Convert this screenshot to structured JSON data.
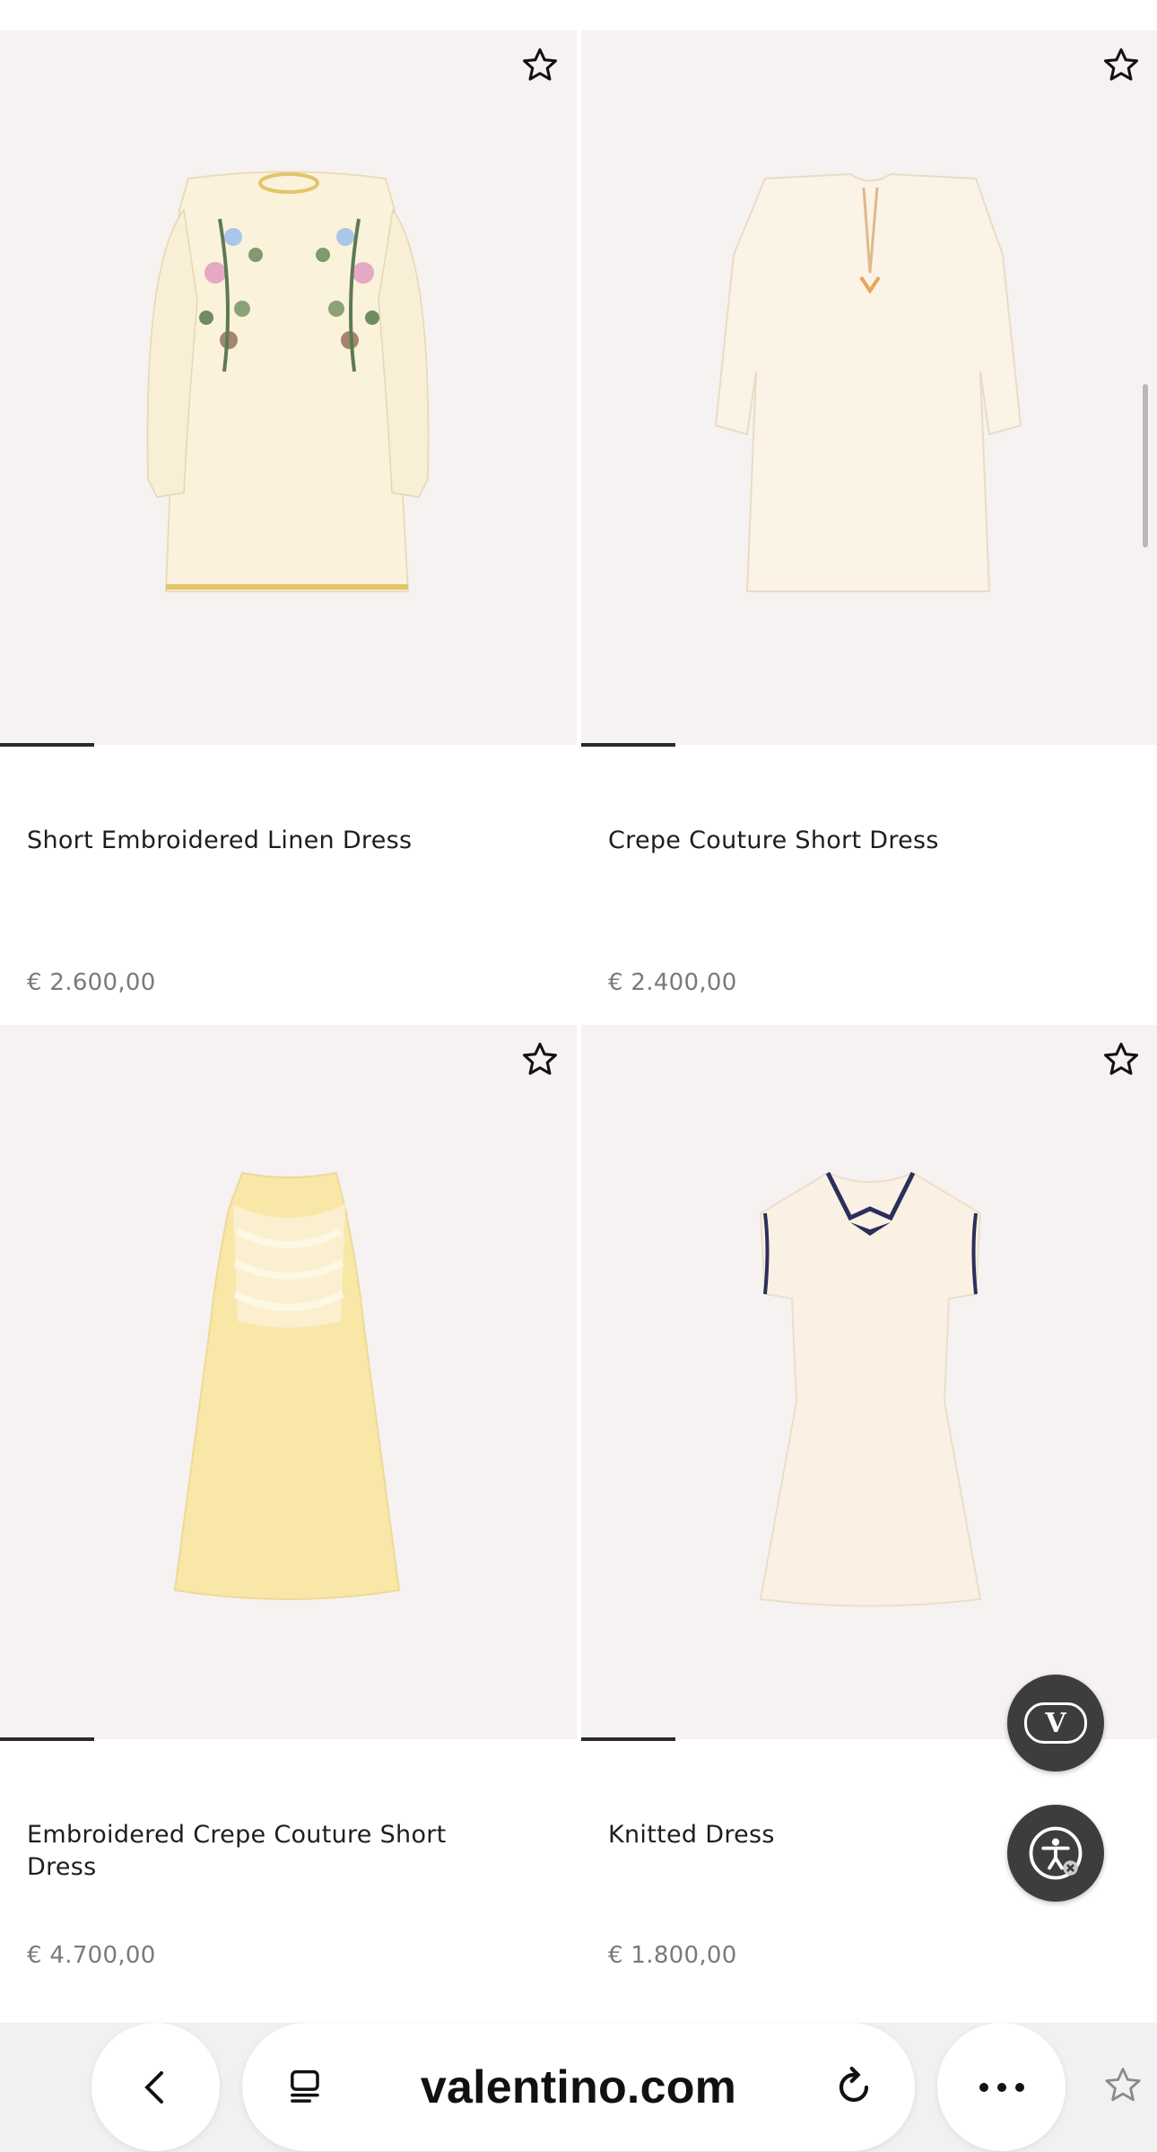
{
  "products": [
    {
      "title": "Short Embroidered Linen Dress",
      "price": "€ 2.600,00",
      "image": "embroidered-linen-dress"
    },
    {
      "title": "Crepe Couture Short Dress",
      "price": "€ 2.400,00",
      "image": "crepe-short-dress"
    },
    {
      "title": "Embroidered Crepe Couture Short Dress",
      "price": "€ 4.700,00",
      "image": "yellow-embroidered-dress"
    },
    {
      "title": "Knitted Dress",
      "price": "€ 1.800,00",
      "image": "knitted-polo-dress"
    }
  ],
  "fab": {
    "brand_logo": "VLogo",
    "accessibility": "accessibility-icon"
  },
  "browser": {
    "url": "valentino.com"
  },
  "colors": {
    "image_bg": "#f6f2f1",
    "price": "#7a7a7a",
    "fab": "#3d3d3d",
    "toolbar": "#f1f0f2"
  }
}
